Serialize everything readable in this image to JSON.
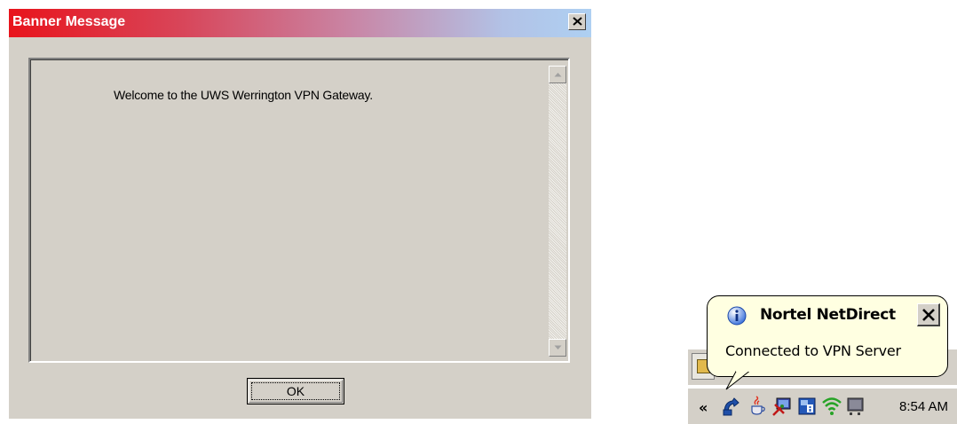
{
  "dialog": {
    "title": "Banner Message",
    "close_label": "×",
    "message": "Welcome to the UWS Werrington VPN Gateway.",
    "ok_label": "OK",
    "colors": {
      "title_gradient_start": "#e8141c",
      "title_gradient_end": "#aed0f2",
      "face": "#d4d0c8"
    }
  },
  "taskbar": {
    "chevron": "«",
    "tray_icons": [
      "nortel-netdirect-icon",
      "java-icon",
      "network-tool-icon",
      "info-card-icon",
      "wireless-icon",
      "monitor-icon"
    ],
    "clock": "8:54 AM"
  },
  "balloon": {
    "title": "Nortel NetDirect",
    "message": "Connected to VPN Server",
    "icon": "info-icon",
    "background": "#ffffe1"
  }
}
